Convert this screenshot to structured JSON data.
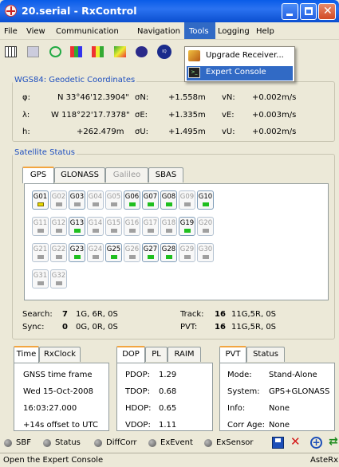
{
  "window": {
    "title": "20.serial - RxControl"
  },
  "menubar": {
    "items": [
      "File",
      "View",
      "Communication",
      "Navigation",
      "Tools",
      "Logging",
      "Help"
    ]
  },
  "tools_menu": {
    "items": [
      "Upgrade Receiver...",
      "Expert Console"
    ]
  },
  "geodetic": {
    "title": "WGS84: Geodetic Coordinates",
    "rows": [
      {
        "label": "φ:",
        "value": "N 33°46'12.3904\"",
        "sig_label": "σN:",
        "sig": "+1.558m",
        "vel_label": "vN:",
        "vel": "+0.002m/s"
      },
      {
        "label": "λ:",
        "value": "W 118°22'17.7378\"",
        "sig_label": "σE:",
        "sig": "+1.335m",
        "vel_label": "vE:",
        "vel": "+0.003m/s"
      },
      {
        "label": "h:",
        "value": "+262.479m",
        "sig_label": "σU:",
        "sig": "+1.495m",
        "vel_label": "vU:",
        "vel": "+0.002m/s"
      }
    ]
  },
  "satellite": {
    "title": "Satellite Status",
    "tabs": [
      "GPS",
      "GLONASS",
      "Galileo",
      "SBAS"
    ],
    "sats": [
      {
        "id": "G01",
        "on": true,
        "ind": "yellow"
      },
      {
        "id": "G02",
        "on": false,
        "ind": "gray"
      },
      {
        "id": "G03",
        "on": true,
        "ind": "gray"
      },
      {
        "id": "G04",
        "on": false,
        "ind": "gray"
      },
      {
        "id": "G05",
        "on": false,
        "ind": "gray"
      },
      {
        "id": "G06",
        "on": true,
        "ind": "green"
      },
      {
        "id": "G07",
        "on": true,
        "ind": "green"
      },
      {
        "id": "G08",
        "on": true,
        "ind": "green"
      },
      {
        "id": "G09",
        "on": false,
        "ind": "gray"
      },
      {
        "id": "G10",
        "on": true,
        "ind": "green"
      },
      {
        "id": "G11",
        "on": false,
        "ind": "gray"
      },
      {
        "id": "G12",
        "on": false,
        "ind": "gray"
      },
      {
        "id": "G13",
        "on": true,
        "ind": "green"
      },
      {
        "id": "G14",
        "on": false,
        "ind": "gray"
      },
      {
        "id": "G15",
        "on": false,
        "ind": "gray"
      },
      {
        "id": "G16",
        "on": false,
        "ind": "gray"
      },
      {
        "id": "G17",
        "on": false,
        "ind": "gray"
      },
      {
        "id": "G18",
        "on": false,
        "ind": "gray"
      },
      {
        "id": "G19",
        "on": true,
        "ind": "green"
      },
      {
        "id": "G20",
        "on": false,
        "ind": "gray"
      },
      {
        "id": "G21",
        "on": false,
        "ind": "gray"
      },
      {
        "id": "G22",
        "on": false,
        "ind": "gray"
      },
      {
        "id": "G23",
        "on": true,
        "ind": "green"
      },
      {
        "id": "G24",
        "on": false,
        "ind": "gray"
      },
      {
        "id": "G25",
        "on": true,
        "ind": "green"
      },
      {
        "id": "G26",
        "on": false,
        "ind": "gray"
      },
      {
        "id": "G27",
        "on": true,
        "ind": "green"
      },
      {
        "id": "G28",
        "on": true,
        "ind": "green"
      },
      {
        "id": "G29",
        "on": false,
        "ind": "gray"
      },
      {
        "id": "G30",
        "on": false,
        "ind": "gray"
      },
      {
        "id": "G31",
        "on": false,
        "ind": "gray"
      },
      {
        "id": "G32",
        "on": false,
        "ind": "gray"
      }
    ],
    "search_label": "Search:",
    "search_num": "7",
    "search_detail": "1G, 6R, 0S",
    "sync_label": "Sync:",
    "sync_num": "0",
    "sync_detail": "0G, 0R, 0S",
    "track_label": "Track:",
    "track_num": "16",
    "track_detail": "11G,5R, 0S",
    "pvt_label": "PVT:",
    "pvt_num": "16",
    "pvt_detail": "11G,5R, 0S"
  },
  "time_panel": {
    "tabs": [
      "Time",
      "RxClock"
    ],
    "lines": [
      "GNSS time frame",
      "Wed 15-Oct-2008",
      "16:03:27.000",
      "+14s offset to UTC"
    ]
  },
  "dop_panel": {
    "tabs": [
      "DOP",
      "PL",
      "RAIM"
    ],
    "rows": [
      {
        "k": "PDOP:",
        "v": "1.29"
      },
      {
        "k": "TDOP:",
        "v": "0.68"
      },
      {
        "k": "HDOP:",
        "v": "0.65"
      },
      {
        "k": "VDOP:",
        "v": "1.11"
      }
    ]
  },
  "pvt_panel": {
    "tabs": [
      "PVT",
      "Status"
    ],
    "rows": [
      {
        "k": "Mode:",
        "v": "Stand-Alone"
      },
      {
        "k": "System:",
        "v": "GPS+GLONASS"
      },
      {
        "k": "Info:",
        "v": "None"
      },
      {
        "k": "Corr Age:",
        "v": "None"
      }
    ]
  },
  "bottom": {
    "items": [
      "SBF",
      "Status",
      "DiffCorr",
      "ExEvent",
      "ExSensor"
    ]
  },
  "statusbar": {
    "message": "Open the Expert Console",
    "right": "AsteRx"
  },
  "colors": {
    "title_bar": "#0a5ce8",
    "highlight": "#316ac5",
    "group_label": "#1e4fbf",
    "active_tab_top": "#f2a540",
    "sat_green": "#1fbf1f",
    "sat_yellow": "#e8d800"
  }
}
